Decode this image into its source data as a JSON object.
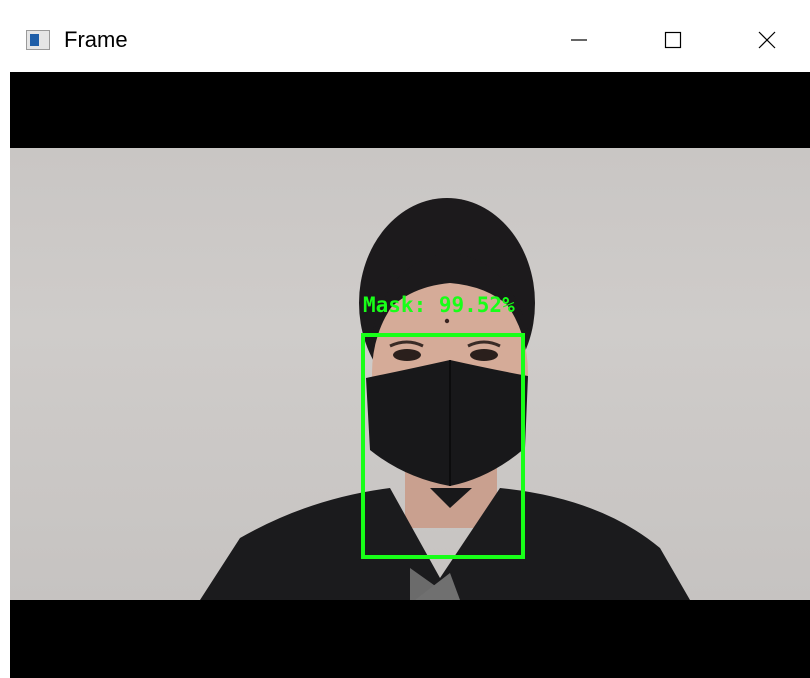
{
  "window": {
    "title": "Frame",
    "icon": "opencv-window-icon",
    "controls": {
      "minimize": "minimize-icon",
      "maximize": "maximize-icon",
      "close": "close-icon"
    }
  },
  "detection": {
    "label": "Mask: 99.52%",
    "color": "#18ff18"
  }
}
